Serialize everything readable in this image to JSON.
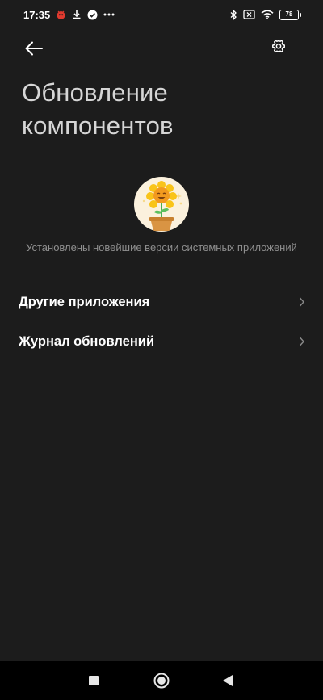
{
  "status_bar": {
    "time": "17:35",
    "battery_level": "78",
    "left_icons": [
      "bug-notification-icon",
      "download-icon",
      "check-circle-icon",
      "more-dots-icon"
    ],
    "right_icons": [
      "bluetooth-icon",
      "no-sim-icon",
      "wifi-icon",
      "battery-icon"
    ]
  },
  "header": {
    "title": "Обновление компонентов"
  },
  "main": {
    "illustration": "sunflower-pot-illustration",
    "status_text": "Установлены новейшие версии системных приложений",
    "items": [
      {
        "label": "Другие приложения"
      },
      {
        "label": "Журнал обновлений"
      }
    ]
  },
  "colors": {
    "background": "#1c1c1c",
    "title": "#d6d6d6",
    "secondary_text": "#8f8f8f",
    "nav_bar": "#000000"
  }
}
